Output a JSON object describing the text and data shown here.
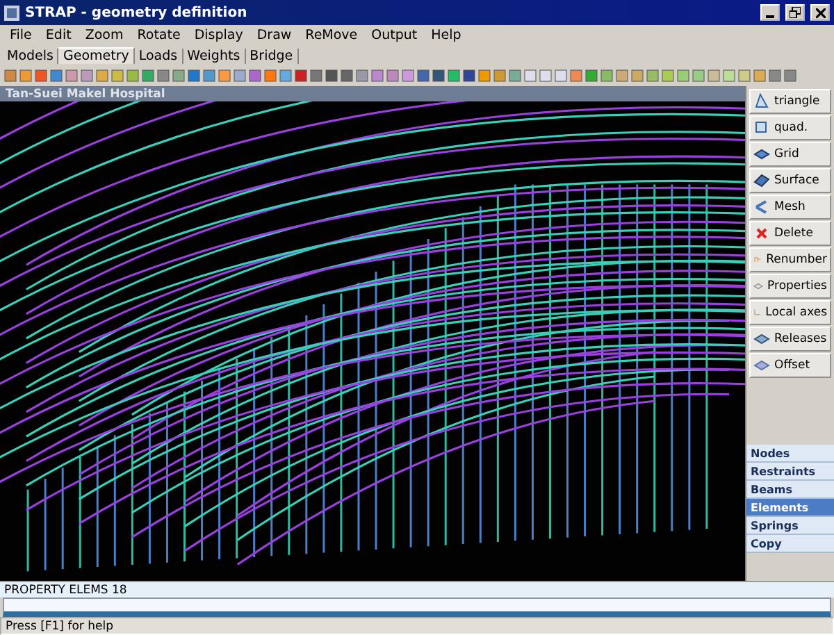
{
  "window": {
    "title": "STRAP - geometry definition"
  },
  "menu": [
    "File",
    "Edit",
    "Zoom",
    "Rotate",
    "Display",
    "Draw",
    "ReMove",
    "Output",
    "Help"
  ],
  "tabs": [
    {
      "label": "Models",
      "selected": false
    },
    {
      "label": "Geometry",
      "selected": true
    },
    {
      "label": "Loads",
      "selected": false
    },
    {
      "label": "Weights",
      "selected": false
    },
    {
      "label": "Bridge",
      "selected": false
    }
  ],
  "viewport": {
    "title": "Tan-Suei Makel Hospital"
  },
  "tools": [
    {
      "label": "triangle",
      "kind": "triangle"
    },
    {
      "label": "quad.",
      "kind": "quad"
    },
    {
      "label": "Grid",
      "kind": "grid"
    },
    {
      "label": "Surface",
      "kind": "surface"
    },
    {
      "label": "Mesh",
      "kind": "mesh"
    },
    {
      "label": "Delete",
      "kind": "delete"
    },
    {
      "label": "Renumber",
      "kind": "renumber"
    },
    {
      "label": "Properties",
      "kind": "properties"
    },
    {
      "label": "Local axes",
      "kind": "axes"
    },
    {
      "label": "Releases",
      "kind": "releases"
    },
    {
      "label": "Offset",
      "kind": "offset"
    }
  ],
  "categories": [
    {
      "label": "Nodes",
      "selected": false
    },
    {
      "label": "Restraints",
      "selected": false
    },
    {
      "label": "Beams",
      "selected": false
    },
    {
      "label": "Elements",
      "selected": true
    },
    {
      "label": "Springs",
      "selected": false
    },
    {
      "label": "Copy",
      "selected": false
    }
  ],
  "property_bar": {
    "label": "PROPERTY ELEMS 18"
  },
  "status_bar": {
    "text": "Press [F1] for help"
  }
}
